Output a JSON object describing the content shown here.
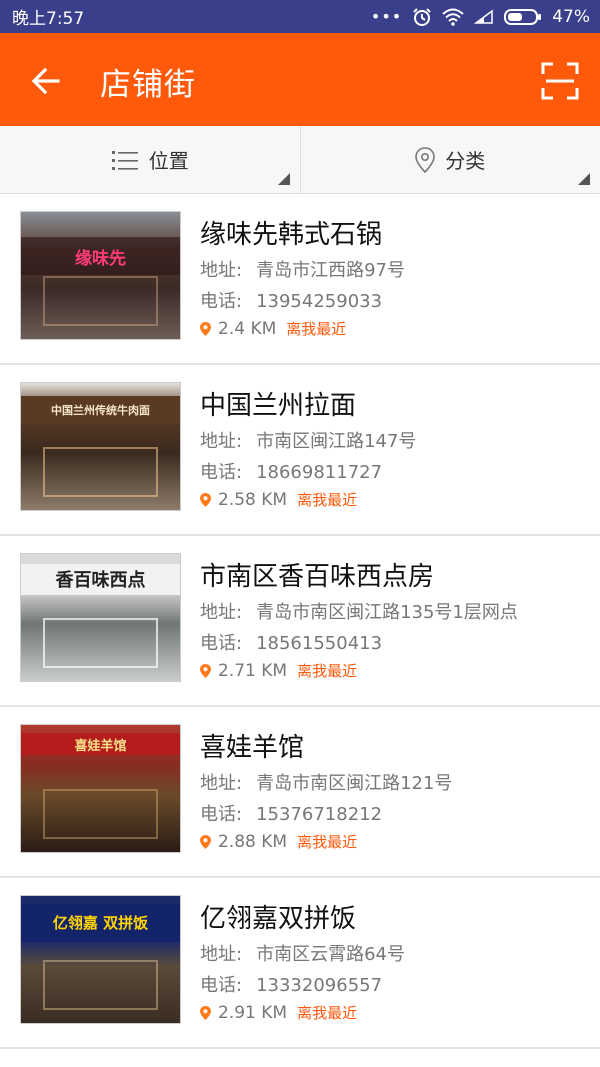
{
  "status": {
    "time": "晚上7:57",
    "dots": "•••",
    "battery": "47%"
  },
  "toolbar": {
    "title": "店铺街",
    "back_icon": "arrow-left-icon",
    "scan_icon": "scan-icon",
    "bg_color": "#ff5a0c"
  },
  "filters": {
    "location": "位置",
    "category": "分类"
  },
  "shops": [
    {
      "name": "缘味先韩式石锅",
      "address_label": "地址:",
      "address": "青岛市江西路97号",
      "phone_label": "电话:",
      "phone": "13954259033",
      "distance": "2.4 KM",
      "near_label": "离我最近"
    },
    {
      "name": "中国兰州拉面",
      "address_label": "地址:",
      "address": "市南区闽江路147号",
      "phone_label": "电话:",
      "phone": "18669811727",
      "distance": "2.58 KM",
      "near_label": "离我最近"
    },
    {
      "name": "市南区香百味西点房",
      "address_label": "地址:",
      "address": "青岛市南区闽江路135号1层网点",
      "phone_label": "电话:",
      "phone": "18561550413",
      "distance": "2.71 KM",
      "near_label": "离我最近"
    },
    {
      "name": "喜娃羊馆",
      "address_label": "地址:",
      "address": "青岛市南区闽江路121号",
      "phone_label": "电话:",
      "phone": "15376718212",
      "distance": "2.88 KM",
      "near_label": "离我最近"
    },
    {
      "name": "亿翎嘉双拼饭",
      "address_label": "地址:",
      "address": "市南区云霄路64号",
      "phone_label": "电话:",
      "phone": "13332096557",
      "distance": "2.91 KM",
      "near_label": "离我最近"
    }
  ],
  "thumb_signs": [
    "缘味先",
    "中国兰州传统牛肉面",
    "香百味西点",
    "喜娃羊馆",
    "亿翎嘉 双拼饭"
  ]
}
